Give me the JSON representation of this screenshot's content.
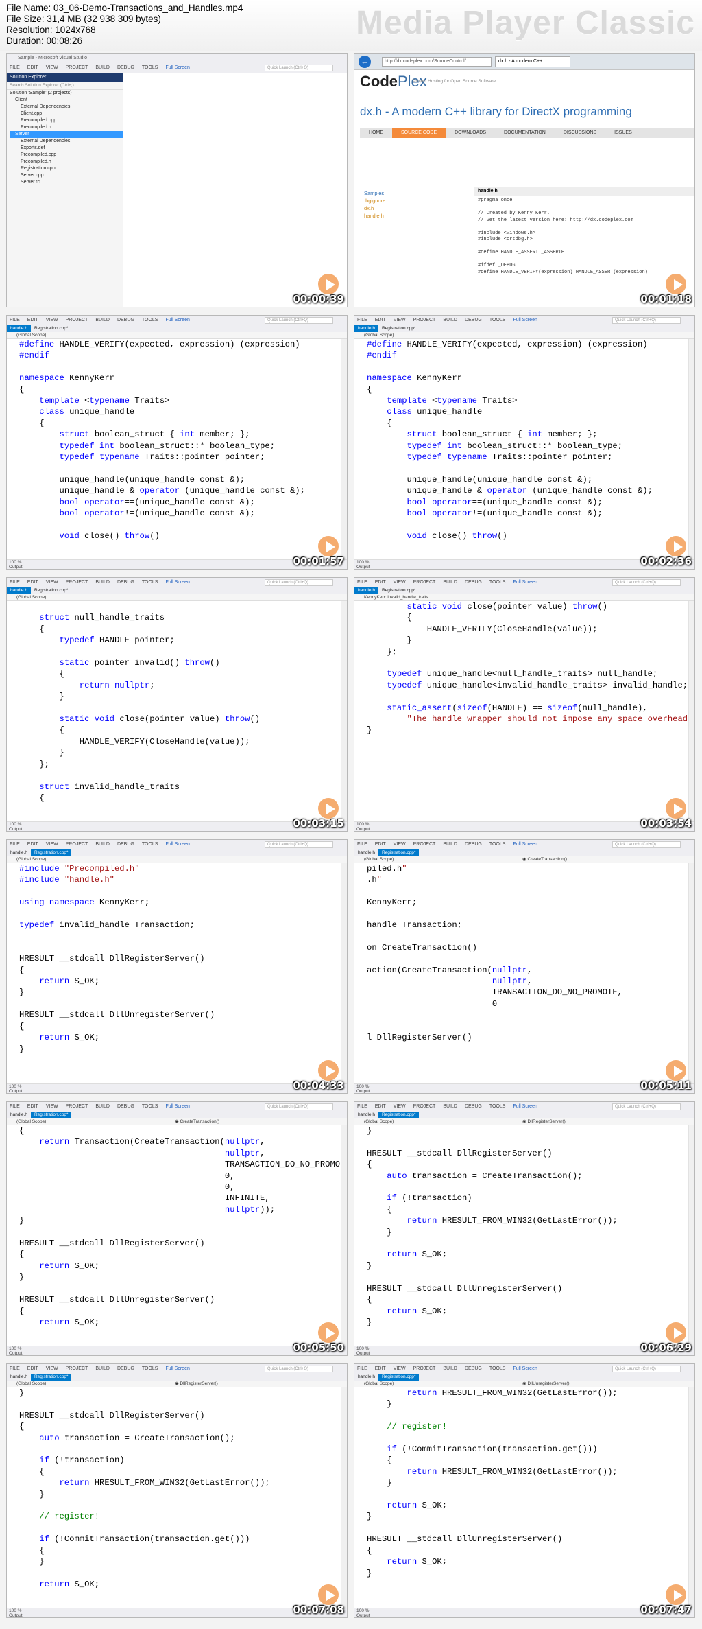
{
  "file_info": {
    "name": "File Name: 03_06-Demo-Transactions_and_Handles.mp4",
    "size": "File Size: 31,4 MB (32 938 309 bytes)",
    "resolution": "Resolution: 1024x768",
    "duration": "Duration: 00:08:26"
  },
  "brand": "Media Player Classic",
  "vs_menu": [
    "FILE",
    "EDIT",
    "VIEW",
    "PROJECT",
    "BUILD",
    "DEBUG",
    "TOOLS",
    "Full Screen"
  ],
  "quick_launch": "Quick Launch (Ctrl+Q)",
  "frames": [
    {
      "time": "00:00:39"
    },
    {
      "time": "00:01:18"
    },
    {
      "time": "00:01:57"
    },
    {
      "time": "00:02:36"
    },
    {
      "time": "00:03:15"
    },
    {
      "time": "00:03:54"
    },
    {
      "time": "00:04:33"
    },
    {
      "time": "00:05:11"
    },
    {
      "time": "00:05:50"
    },
    {
      "time": "00:06:29"
    },
    {
      "time": "00:07:08"
    },
    {
      "time": "00:07:47"
    }
  ],
  "vs_title": "Sample - Microsoft Visual Studio",
  "solution_explorer": {
    "title": "Solution Explorer",
    "search": "Search Solution Explorer (Ctrl+;)",
    "items": [
      "Solution 'Sample' (2 projects)",
      "Client",
      "External Dependencies",
      "Client.cpp",
      "Precompiled.cpp",
      "Precompiled.h",
      "Server",
      "External Dependencies",
      "Exports.def",
      "Precompiled.cpp",
      "Precompiled.h",
      "Registration.cpp",
      "Server.cpp",
      "Server.rc"
    ]
  },
  "codeplex": {
    "url": "http://dx.codeplex.com/SourceControl/",
    "tab": "dx.h - A modern C++...",
    "logo_a": "Code",
    "logo_b": "Plex",
    "subtitle": "Project Hosting for Open Source Software",
    "title": "dx.h - A modern C++ library for DirectX programming",
    "nav": [
      "HOME",
      "SOURCE CODE",
      "DOWNLOADS",
      "DOCUMENTATION",
      "DISCUSSIONS",
      "ISSUES"
    ],
    "files": [
      "Samples",
      ".hgignore",
      "dx.h",
      "handle.h"
    ],
    "file_header": "handle.h",
    "code": "#pragma once\n\n// Created by Kenny Kerr.\n// Get the latest version here: http://dx.codeplex.com\n\n#include <windows.h>\n#include <crtdbg.h>\n\n#define HANDLE_ASSERT _ASSERTE\n\n#ifdef _DEBUG\n#define HANDLE_VERIFY(expression) HANDLE_ASSERT(expression)"
  },
  "status_zoom": "100 %",
  "status_output": "Output",
  "code_blocks": [
    "",
    "",
    "#define HANDLE_VERIFY(expected, expression) (expression)\n#endif\n\nnamespace KennyKerr\n{\n    template <typename Traits>\n    class unique_handle\n    {\n        struct boolean_struct { int member; };\n        typedef int boolean_struct::* boolean_type;\n        typedef typename Traits::pointer pointer;\n\n        unique_handle(unique_handle const &);\n        unique_handle & operator=(unique_handle const &);\n        bool operator==(unique_handle const &);\n        bool operator!=(unique_handle const &);\n\n        void close() throw()",
    "#define HANDLE_VERIFY(expected, expression) (expression)\n#endif\n\nnamespace KennyKerr\n{\n    template <typename Traits>\n    class unique_handle\n    {\n        struct boolean_struct { int member; };\n        typedef int boolean_struct::* boolean_type;\n        typedef typename Traits::pointer pointer;\n\n        unique_handle(unique_handle const &);\n        unique_handle & operator=(unique_handle const &);\n        bool operator==(unique_handle const &);\n        bool operator!=(unique_handle const &);\n\n        void close() throw()",
    "\n    struct null_handle_traits\n    {\n        typedef HANDLE pointer;\n\n        static pointer invalid() throw()\n        {\n            return nullptr;\n        }\n\n        static void close(pointer value) throw()\n        {\n            HANDLE_VERIFY(CloseHandle(value));\n        }\n    };\n\n    struct invalid_handle_traits\n    {",
    "        static void close(pointer value) throw()\n        {\n            HANDLE_VERIFY(CloseHandle(value));\n        }\n    };\n\n    typedef unique_handle<null_handle_traits> null_handle;\n    typedef unique_handle<invalid_handle_traits> invalid_handle;\n\n    static_assert(sizeof(HANDLE) == sizeof(null_handle),\n        \"The handle wrapper should not impose any space overhead\n}",
    "#include \"Precompiled.h\"\n#include \"handle.h\"\n\nusing namespace KennyKerr;\n\ntypedef invalid_handle Transaction;\n\n\nHRESULT __stdcall DllRegisterServer()\n{\n    return S_OK;\n}\n\nHRESULT __stdcall DllUnregisterServer()\n{\n    return S_OK;\n}",
    "piled.h\"\n.h\"\n\nKennyKerr;\n\nhandle Transaction;\n\non CreateTransaction()\n\naction(CreateTransaction(nullptr,\n                         nullptr,\n                         TRANSACTION_DO_NO_PROMOTE,\n                         0\n\n\nl DllRegisterServer()",
    "{\n    return Transaction(CreateTransaction(nullptr,\n                                         nullptr,\n                                         TRANSACTION_DO_NO_PROMO\n                                         0,\n                                         0,\n                                         INFINITE,\n                                         nullptr));\n}\n\nHRESULT __stdcall DllRegisterServer()\n{\n    return S_OK;\n}\n\nHRESULT __stdcall DllUnregisterServer()\n{\n    return S_OK;",
    "}\n\nHRESULT __stdcall DllRegisterServer()\n{\n    auto transaction = CreateTransaction();\n\n    if (!transaction)\n    {\n        return HRESULT_FROM_WIN32(GetLastError());\n    }\n\n    return S_OK;\n}\n\nHRESULT __stdcall DllUnregisterServer()\n{\n    return S_OK;\n}",
    "}\n\nHRESULT __stdcall DllRegisterServer()\n{\n    auto transaction = CreateTransaction();\n\n    if (!transaction)\n    {\n        return HRESULT_FROM_WIN32(GetLastError());\n    }\n\n    // register!\n\n    if (!CommitTransaction(transaction.get()))\n    {\n    }\n\n    return S_OK;",
    "        return HRESULT_FROM_WIN32(GetLastError());\n    }\n\n    // register!\n\n    if (!CommitTransaction(transaction.get()))\n    {\n        return HRESULT_FROM_WIN32(GetLastError());\n    }\n\n    return S_OK;\n}\n\nHRESULT __stdcall DllUnregisterServer()\n{\n    return S_OK;\n}"
  ],
  "file_tabs": [
    {},
    {},
    {
      "tabs": [
        "handle.h",
        "Registration.cpp*"
      ],
      "active": 0,
      "scope": "(Global Scope)",
      "scope2": ""
    },
    {
      "tabs": [
        "handle.h",
        "Registration.cpp*"
      ],
      "active": 0,
      "scope": "(Global Scope)",
      "scope2": ""
    },
    {
      "tabs": [
        "handle.h",
        "Registration.cpp*"
      ],
      "active": 0,
      "scope": "(Global Scope)",
      "scope2": ""
    },
    {
      "tabs": [
        "handle.h",
        "Registration.cpp*"
      ],
      "active": 0,
      "scope": "KennyKerr::invalid_handle_traits",
      "scope2": ""
    },
    {
      "tabs": [
        "handle.h",
        "Registration.cpp*"
      ],
      "active": 1,
      "scope": "(Global Scope)",
      "scope2": ""
    },
    {
      "tabs": [
        "handle.h",
        "Registration.cpp*"
      ],
      "active": 1,
      "scope": "(Global Scope)",
      "scope2": "CreateTransaction()"
    },
    {
      "tabs": [
        "handle.h",
        "Registration.cpp*"
      ],
      "active": 1,
      "scope": "(Global Scope)",
      "scope2": "CreateTransaction()"
    },
    {
      "tabs": [
        "handle.h",
        "Registration.cpp*"
      ],
      "active": 1,
      "scope": "(Global Scope)",
      "scope2": "DllRegisterServer()"
    },
    {
      "tabs": [
        "handle.h",
        "Registration.cpp*"
      ],
      "active": 1,
      "scope": "(Global Scope)",
      "scope2": "DllRegisterServer()"
    },
    {
      "tabs": [
        "handle.h",
        "Registration.cpp*"
      ],
      "active": 1,
      "scope": "(Global Scope)",
      "scope2": "DllUnregisterServer()"
    }
  ]
}
